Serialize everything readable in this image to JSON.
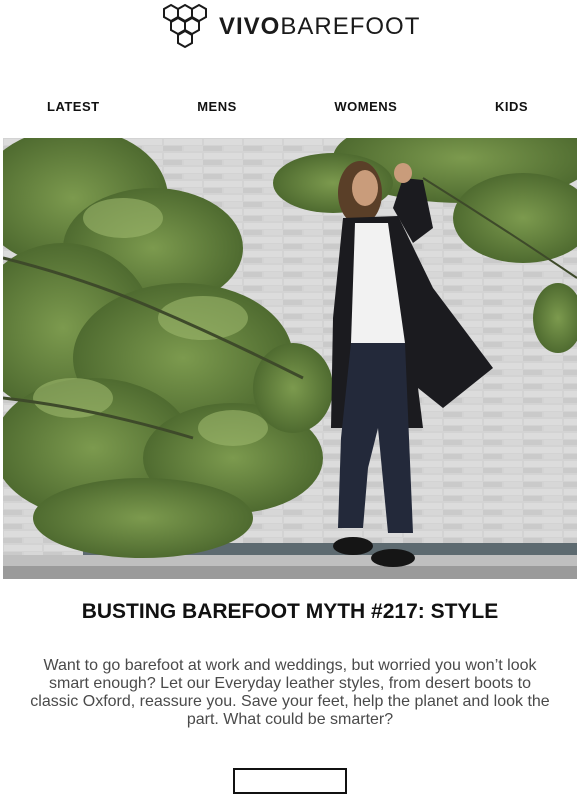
{
  "brand": {
    "name_bold": "VIVO",
    "name_regular": "BAREFOOT"
  },
  "nav": {
    "items": [
      {
        "label": "LATEST"
      },
      {
        "label": "MENS"
      },
      {
        "label": "WOMENS"
      },
      {
        "label": "KIDS"
      }
    ]
  },
  "article": {
    "headline": "BUSTING BAREFOOT MYTH #217: STYLE",
    "body": "Want to go barefoot at work and weddings, but worried you won’t look smart enough? Let our Everyday leather styles, from desert boots to classic Oxford, reassure you. Save your feet, help the planet and look the part. What could be smarter?"
  },
  "colors": {
    "wall": "#cfcfcf",
    "foliage": "#6f8d45",
    "coat": "#1b1b1f",
    "jeans": "#23293a",
    "text": "#111111"
  }
}
